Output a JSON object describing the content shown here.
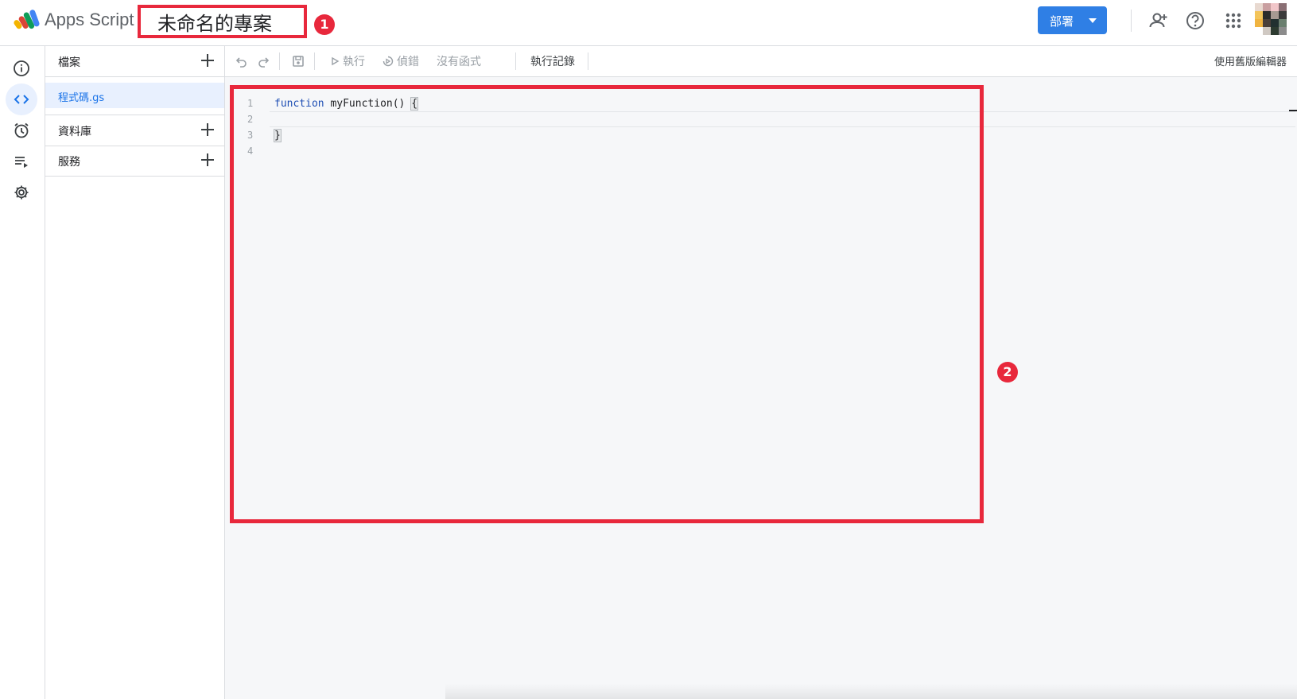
{
  "header": {
    "app_name": "Apps Script",
    "project_title": "未命名的專案",
    "deploy_label": "部署",
    "annotations": [
      "1",
      "2"
    ]
  },
  "rail": {
    "items": [
      {
        "icon": "info-icon"
      },
      {
        "icon": "code-icon",
        "active": true
      },
      {
        "icon": "alarm-icon"
      },
      {
        "icon": "playlist-icon"
      },
      {
        "icon": "gear-icon"
      }
    ]
  },
  "files_panel": {
    "files_label": "檔案",
    "file_name": "程式碼.gs",
    "libraries_label": "資料庫",
    "services_label": "服務"
  },
  "toolbar": {
    "run_label": "執行",
    "debug_label": "偵錯",
    "function_label": "沒有函式",
    "log_label": "執行記錄",
    "legacy_label": "使用舊版編輯器"
  },
  "editor": {
    "line_numbers": [
      "1",
      "2",
      "3",
      "4"
    ],
    "code": {
      "keyword": "function",
      "rest": " myFunction() ",
      "open_brace": "{",
      "close_brace": "}"
    }
  },
  "colors": {
    "accent": "#2f7fe5",
    "annotation_red": "#e8283c",
    "selected_bg": "#e8f0fe",
    "link_blue": "#1a73e8",
    "editor_bg": "#f6f7f9"
  }
}
